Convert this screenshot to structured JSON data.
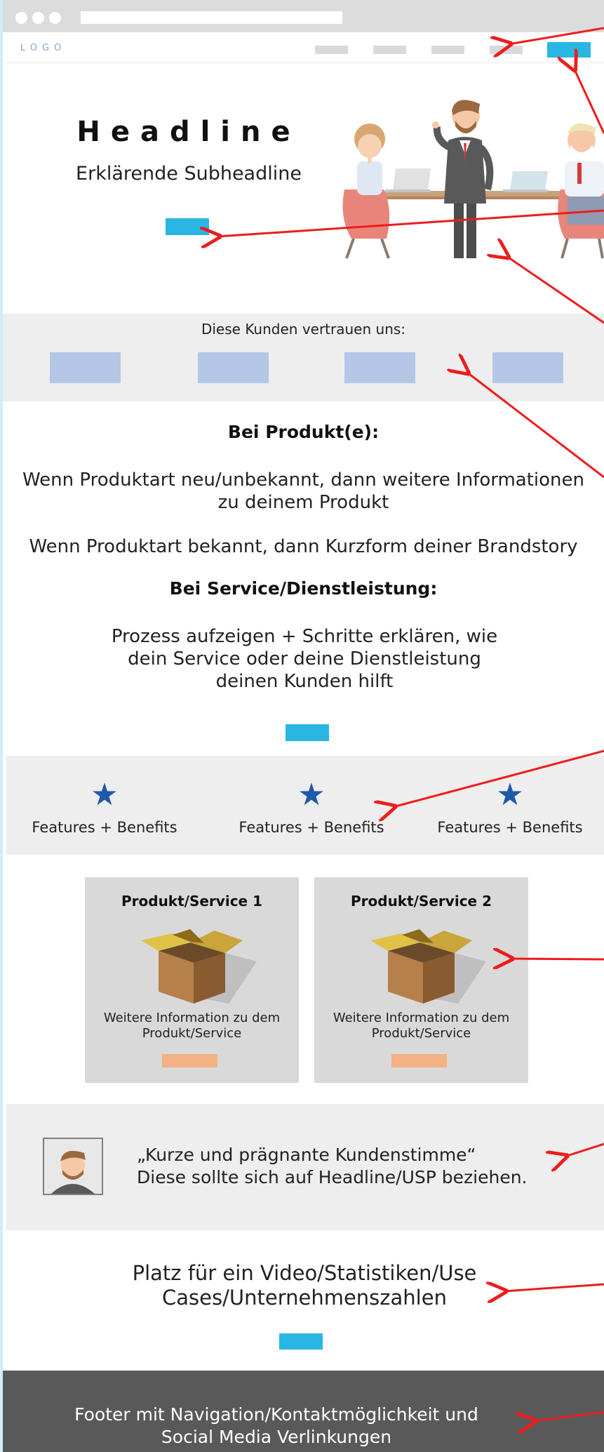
{
  "nav": {
    "logo": "LOGO",
    "item_count": 4
  },
  "hero": {
    "headline": "Headline",
    "subheadline": "Erklärende Subheadline"
  },
  "clients": {
    "title": "Diese Kunden vertrauen uns:"
  },
  "content": {
    "product_heading": "Bei Produkt(e):",
    "product_para1": "Wenn Produktart neu/unbekannt, dann weitere Informationen zu deinem Produkt",
    "product_para2": "Wenn Produktart bekannt, dann Kurzform deiner Brandstory",
    "service_heading": "Bei Service/Dienstleistung:",
    "service_para": "Prozess aufzeigen + Schritte erklären, wie dein Service oder deine Dienstleistung deinen Kunden hilft"
  },
  "features": [
    {
      "label": "Features + Benefits"
    },
    {
      "label": "Features + Benefits"
    },
    {
      "label": "Features + Benefits"
    }
  ],
  "cards": [
    {
      "title": "Produkt/Service 1",
      "info": "Weitere Information zu dem Produkt/Service"
    },
    {
      "title": "Produkt/Service 2",
      "info": "Weitere Information zu dem Produkt/Service"
    }
  ],
  "testimonial": {
    "quote_line1": "„Kurze und prägnante Kundenstimme“",
    "quote_line2": "Diese sollte sich auf Headline/USP beziehen."
  },
  "video": {
    "text": "Platz für ein Video/Statistiken/Use Cases/Unternehmenszahlen"
  },
  "footer": {
    "text": "Footer mit Navigation/Kontaktmöglichkeit und Social Media Verlinkungen"
  },
  "colors": {
    "cta": "#29b6e3",
    "client_logo": "#b4c7e7",
    "card_button": "#f4b183",
    "star": "#1f5aa6",
    "footer": "#595959",
    "annotation_arrow": "#ee1c1c"
  }
}
